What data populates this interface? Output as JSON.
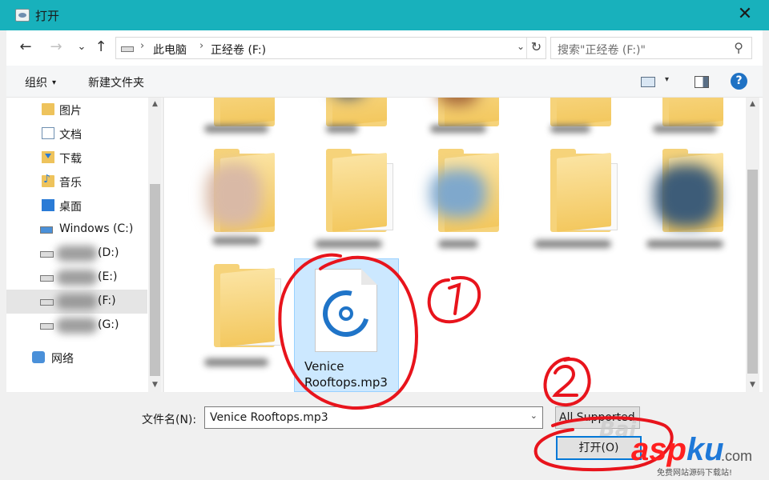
{
  "window": {
    "title": "打开",
    "close_glyph": "✕"
  },
  "nav": {
    "back_glyph": "←",
    "forward_glyph": "→",
    "recent_glyph": "⌄",
    "up_glyph": "↑",
    "breadcrumb": [
      "此电脑",
      "正经卷 (F:)"
    ],
    "separator_glyph": "›",
    "dropdown_glyph": "⌄",
    "refresh_glyph": "↻",
    "search_placeholder": "搜索\"正经卷 (F:)\"",
    "search_glyph": "⚲"
  },
  "toolbar": {
    "organize_label": "组织",
    "new_folder_label": "新建文件夹",
    "help_glyph": "?",
    "dropdown_glyph": "▾"
  },
  "sidebar": {
    "items": [
      {
        "label": "图片",
        "icon": "pictures-icon"
      },
      {
        "label": "文档",
        "icon": "documents-icon"
      },
      {
        "label": "下载",
        "icon": "downloads-icon"
      },
      {
        "label": "音乐",
        "icon": "music-icon"
      },
      {
        "label": "桌面",
        "icon": "desktop-icon"
      },
      {
        "label": "Windows (C:)",
        "icon": "windows-drive-icon"
      },
      {
        "label": "(D:)",
        "icon": "drive-icon"
      },
      {
        "label": "(E:)",
        "icon": "drive-icon"
      },
      {
        "label": "(F:)",
        "icon": "drive-icon",
        "selected": true
      },
      {
        "label": "(G:)",
        "icon": "drive-icon"
      },
      {
        "label": "网络",
        "icon": "network-icon"
      }
    ],
    "scroll_up_glyph": "▲",
    "scroll_down_glyph": "▼"
  },
  "files": {
    "selected": {
      "name_line1": "Venice",
      "name_line2": "Rooftops.mp3",
      "icon": "audio-file-icon"
    }
  },
  "bottom": {
    "filename_label": "文件名(N):",
    "filename_value": "Venice Rooftops.mp3",
    "filter_value": "All Supported",
    "open_label": "打开(O)",
    "dropdown_glyph": "⌄"
  },
  "annotations": {
    "circle_1_label": "1",
    "circle_2_label": "2"
  },
  "watermark": {
    "baidu": "Bai",
    "brand_main": "asp",
    "brand_ku": "ku",
    "domain": ".com",
    "tagline": "免费网站源码下载站!"
  },
  "colors": {
    "titlebar": "#18b1bc",
    "selection": "#cce8ff",
    "accent": "#0078d7",
    "annotation_red": "#e8141c"
  }
}
